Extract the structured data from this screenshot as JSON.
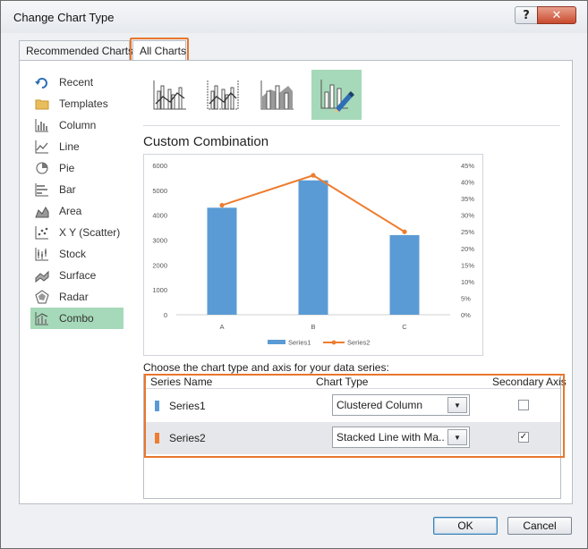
{
  "window": {
    "title": "Change Chart Type",
    "help_label": "?",
    "close_label": "✕"
  },
  "tabs": [
    {
      "label": "Recommended Charts"
    },
    {
      "label": "All Charts"
    }
  ],
  "chart_types": [
    {
      "label": "Recent",
      "icon": "recent-icon"
    },
    {
      "label": "Templates",
      "icon": "folder-icon"
    },
    {
      "label": "Column",
      "icon": "column-chart-icon"
    },
    {
      "label": "Line",
      "icon": "line-chart-icon"
    },
    {
      "label": "Pie",
      "icon": "pie-chart-icon"
    },
    {
      "label": "Bar",
      "icon": "bar-chart-icon"
    },
    {
      "label": "Area",
      "icon": "area-chart-icon"
    },
    {
      "label": "X Y (Scatter)",
      "icon": "scatter-chart-icon"
    },
    {
      "label": "Stock",
      "icon": "stock-chart-icon"
    },
    {
      "label": "Surface",
      "icon": "surface-chart-icon"
    },
    {
      "label": "Radar",
      "icon": "radar-chart-icon"
    },
    {
      "label": "Combo",
      "icon": "combo-chart-icon",
      "selected": true
    }
  ],
  "section_title": "Custom Combination",
  "chart_data": {
    "type": "bar",
    "categories": [
      "A",
      "B",
      "C"
    ],
    "series": [
      {
        "name": "Series1",
        "type": "column",
        "axis": "primary",
        "values": [
          4300,
          5400,
          3200
        ],
        "color": "#5b9bd5"
      },
      {
        "name": "Series2",
        "type": "line",
        "axis": "secondary",
        "values": [
          0.33,
          0.42,
          0.25
        ],
        "color": "#ed7d31"
      }
    ],
    "y_primary": {
      "ticks": [
        "0",
        "1000",
        "2000",
        "3000",
        "4000",
        "5000",
        "6000"
      ],
      "ylim": [
        0,
        6000
      ]
    },
    "y_secondary": {
      "ticks": [
        "0%",
        "5%",
        "10%",
        "15%",
        "20%",
        "25%",
        "30%",
        "35%",
        "40%",
        "45%"
      ],
      "ylim": [
        0,
        0.45
      ]
    },
    "legend": "bottom"
  },
  "series_prompt": "Choose the chart type and axis for your data series:",
  "grid": {
    "headers": {
      "name": "Series Name",
      "type": "Chart Type",
      "axis": "Secondary Axis"
    },
    "rows": [
      {
        "name": "Series1",
        "chart_type": "Clustered Column",
        "secondary": false,
        "color": "#5b9bd5"
      },
      {
        "name": "Series2",
        "chart_type": "Stacked Line with Ma...",
        "secondary": true,
        "color": "#ed7d31"
      }
    ]
  },
  "buttons": {
    "ok": "OK",
    "cancel": "Cancel"
  }
}
